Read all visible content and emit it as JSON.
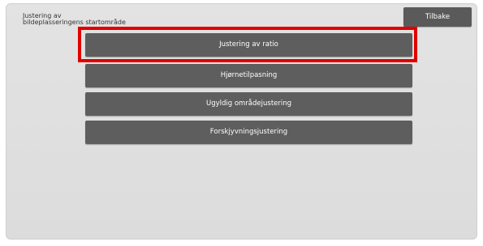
{
  "header": {
    "title": "Justering av\nbildeplasseringens startområde",
    "back_label": "Tilbake"
  },
  "menu": {
    "items": [
      {
        "label": "Justering av ratio",
        "selected": true
      },
      {
        "label": "Hjørnetilpasning",
        "selected": false
      },
      {
        "label": "Ugyldig områdejustering",
        "selected": false
      },
      {
        "label": "Forskjyvningsjustering",
        "selected": false
      }
    ]
  },
  "colors": {
    "button_bg": "#5e5e5e",
    "screen_bg": "#e0e0e0",
    "highlight": "#e00000"
  }
}
